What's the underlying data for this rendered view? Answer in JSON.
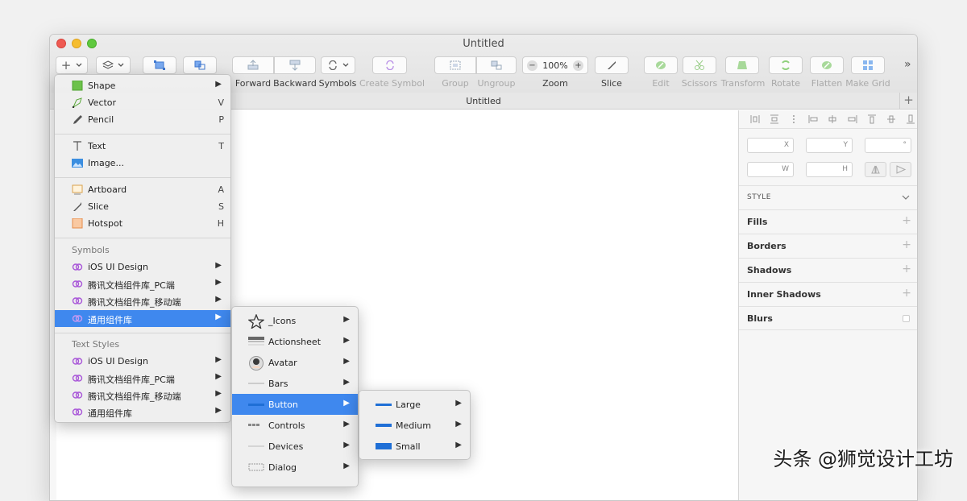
{
  "window": {
    "title": "Untitled",
    "doc_tab_title": "Untitled",
    "add_tab": "+",
    "traffic_lights": {
      "close": "#ee5a52",
      "minimize": "#f5bd2f",
      "zoom": "#5fc93e"
    }
  },
  "toolbar": {
    "insert": "+",
    "items": [
      {
        "label": "Forward",
        "disabled": false
      },
      {
        "label": "Backward",
        "disabled": false
      },
      {
        "label": "Symbols",
        "disabled": false
      },
      {
        "label": "Create Symbol",
        "disabled": true
      },
      {
        "label": "Group",
        "disabled": true
      },
      {
        "label": "Ungroup",
        "disabled": true
      },
      {
        "label": "Zoom",
        "disabled": false
      },
      {
        "label": "Slice",
        "disabled": false
      },
      {
        "label": "Edit",
        "disabled": true
      },
      {
        "label": "Scissors",
        "disabled": true
      },
      {
        "label": "Transform",
        "disabled": true
      },
      {
        "label": "Rotate",
        "disabled": true
      },
      {
        "label": "Flatten",
        "disabled": true
      },
      {
        "label": "Make Grid",
        "disabled": true
      }
    ],
    "zoom_value": "100%",
    "zoom_minus": "−",
    "zoom_plus": "+",
    "overflow": "»"
  },
  "inspector": {
    "fields": {
      "x": "X",
      "y": "Y",
      "rotation": "°",
      "w": "W",
      "h": "H"
    },
    "style_header": "STYLE",
    "sections": [
      "Fills",
      "Borders",
      "Shadows",
      "Inner Shadows",
      "Blurs"
    ]
  },
  "insert_menu": {
    "items": [
      {
        "label": "Shape",
        "shortcut": "",
        "arrow": "▶",
        "icon": "shape-icon"
      },
      {
        "label": "Vector",
        "shortcut": "V",
        "icon": "vector-icon"
      },
      {
        "label": "Pencil",
        "shortcut": "P",
        "icon": "pencil-icon"
      },
      {
        "label": "Text",
        "shortcut": "T",
        "icon": "text-icon"
      },
      {
        "label": "Image...",
        "shortcut": "",
        "icon": "image-icon"
      },
      {
        "label": "Artboard",
        "shortcut": "A",
        "icon": "artboard-icon"
      },
      {
        "label": "Slice",
        "shortcut": "S",
        "icon": "slice-icon"
      },
      {
        "label": "Hotspot",
        "shortcut": "H",
        "icon": "hotspot-icon"
      }
    ],
    "symbols_header": "Symbols",
    "symbols": [
      "iOS UI Design",
      "腾讯文档组件库_PC端",
      "腾讯文档组件库_移动端",
      "通用组件库"
    ],
    "text_styles_header": "Text Styles",
    "text_styles": [
      "iOS UI Design",
      "腾讯文档组件库_PC端",
      "腾讯文档组件库_移动端",
      "通用组件库"
    ],
    "arrow": "▶"
  },
  "library_submenu": {
    "items": [
      "_Icons",
      "Actionsheet",
      "Avatar",
      "Bars",
      "Button",
      "Controls",
      "Devices",
      "Dialog"
    ],
    "selected": "Button"
  },
  "button_submenu": {
    "items": [
      "Large",
      "Medium",
      "Small"
    ]
  },
  "colors": {
    "accent": "#3f88ee",
    "link_icon": "#a855d8",
    "shape_green": "#6cc24a",
    "hotspot_orange": "#f3a66b"
  },
  "watermark": "头条 @狮觉设计工坊"
}
